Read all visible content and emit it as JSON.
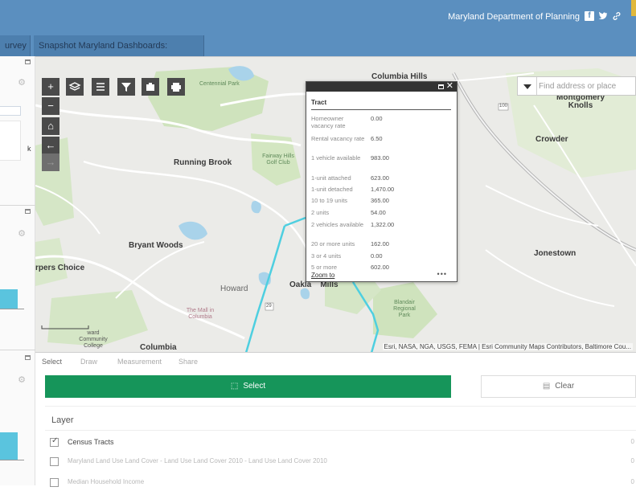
{
  "header": {
    "title": "Maryland Department of Planning",
    "facebook_icon": "f",
    "twitter_icon": "twitter-icon",
    "link_icon": "link-icon",
    "colors": {
      "bar": "#5b8fbf",
      "tab": "#4d7fae"
    }
  },
  "tabs": [
    {
      "label": "urvey"
    },
    {
      "label": "Snapshot Maryland Dashboards: Resources"
    }
  ],
  "map": {
    "search_placeholder": "Find address or place",
    "attribution": "Esri, NASA, NGA, USGS, FEMA | Esri Community Maps Contributors, Baltimore Cou...",
    "labels": {
      "columbia_hills": "Columbia Hills",
      "montgomery_knolls": "Montgomery Knolls",
      "crowder": "Crowder",
      "running_brook": "Running Brook",
      "fairway_hills": "Fairway Hills Golf Club",
      "bryant_woods": "Bryant Woods",
      "harpers_choice": "rpers Choice",
      "howard": "Howard",
      "oakland_mills": "Oakla    Mills",
      "blandair": "Blandair Regional Park",
      "mall": "The Mall in Columbia",
      "college": "ward Community College",
      "columbia": "Columbia",
      "jonestown": "Jonestown",
      "centennial": "Centennial Park",
      "route_100": "100",
      "route_29": "29"
    },
    "tools": {
      "zoom_in": "+",
      "zoom_out": "−",
      "home": "⌂",
      "back": "←",
      "forward": "→"
    }
  },
  "popup": {
    "title": "Tract",
    "rows": [
      {
        "label": "Homeowner vacancy rate",
        "value": "0.00"
      },
      {
        "label": "Rental vacancy rate",
        "value": "6.50"
      },
      {
        "label": "1 vehicle available",
        "value": "983.00"
      },
      {
        "label": "1-unit attached",
        "value": "623.00"
      },
      {
        "label": "1-unit detached",
        "value": "1,470.00"
      },
      {
        "label": "10 to 19 units",
        "value": "365.00"
      },
      {
        "label": "2 units",
        "value": "54.00"
      },
      {
        "label": "2 vehicles available",
        "value": "1,322.00"
      },
      {
        "label": "20 or more units",
        "value": "162.00"
      },
      {
        "label": "3 or 4 units",
        "value": "0.00"
      },
      {
        "label": "5 or more",
        "value": "602.00"
      }
    ],
    "zoom_link": "Zoom to",
    "more": "•••"
  },
  "bottom": {
    "tabs": [
      "Select",
      "Draw",
      "Measurement",
      "Share"
    ],
    "select_label": "Select",
    "clear_label": "Clear",
    "layer_heading": "Layer",
    "layers": [
      {
        "name": "Census Tracts",
        "checked": true,
        "count": "0"
      },
      {
        "name": "Maryland Land Use Land Cover - Land Use Land Cover 2010 - Land Use Land Cover 2010",
        "checked": false,
        "count": "0"
      },
      {
        "name": "Median Household Income",
        "checked": false,
        "count": "0"
      }
    ],
    "accent": "#16955a"
  }
}
